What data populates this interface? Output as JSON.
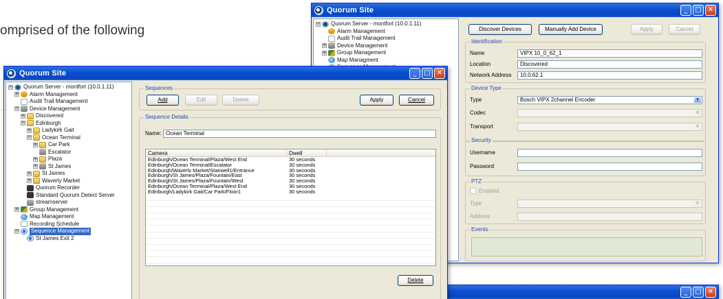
{
  "doc_text": "omprised of the following",
  "window_title": "Quorum Site",
  "title_buttons": {
    "minimize": "_",
    "maximize": "□",
    "close": "✕"
  },
  "tree_front": [
    {
      "label": "Quorum Server - montfort (10.0.1.11)",
      "icon": "server-icon",
      "exp": "⊟",
      "level": 0
    },
    {
      "label": "Alarm Management",
      "icon": "bulb-icon",
      "exp": "⊞",
      "level": 1
    },
    {
      "label": "Audit Trail Management",
      "icon": "doc-icon",
      "exp": "",
      "level": 1
    },
    {
      "label": "Device Management",
      "icon": "camera-icon",
      "exp": "⊟",
      "level": 1
    },
    {
      "label": "Discovered",
      "icon": "folder-icon",
      "exp": "⊞",
      "level": 2
    },
    {
      "label": "Edinburgh",
      "icon": "folder-icon",
      "exp": "⊟",
      "level": 2
    },
    {
      "label": "Ladykirk Gait",
      "icon": "folder-icon",
      "exp": "⊞",
      "level": 3
    },
    {
      "label": "Ocean Terminal",
      "icon": "folder-icon",
      "exp": "⊟",
      "level": 3
    },
    {
      "label": "Car Park",
      "icon": "folder-icon",
      "exp": "⊞",
      "level": 4
    },
    {
      "label": "Escalator",
      "icon": "camera-icon",
      "exp": "",
      "level": 4
    },
    {
      "label": "Plaza",
      "icon": "folder-icon",
      "exp": "⊞",
      "level": 4
    },
    {
      "label": "St James",
      "icon": "camera-icon",
      "exp": "⊞",
      "level": 4
    },
    {
      "label": "St James",
      "icon": "folder-icon",
      "exp": "⊞",
      "level": 3
    },
    {
      "label": "Waverly Market",
      "icon": "folder-icon",
      "exp": "⊞",
      "level": 3
    },
    {
      "label": "Quorum Recorder",
      "icon": "recorder-icon",
      "exp": "",
      "level": 2
    },
    {
      "label": "Standard Quorum Detect Server",
      "icon": "recorder-icon",
      "exp": "",
      "level": 2
    },
    {
      "label": "streamserver",
      "icon": "camera-icon",
      "exp": "",
      "level": 2
    },
    {
      "label": "Group Management",
      "icon": "group-icon",
      "exp": "⊞",
      "level": 1
    },
    {
      "label": "Map Management",
      "icon": "globe-icon",
      "exp": "",
      "level": 1
    },
    {
      "label": "Recording Schedule",
      "icon": "doc-icon",
      "exp": "",
      "level": 1
    },
    {
      "label": "Sequence Management",
      "icon": "sequence-icon",
      "exp": "⊟",
      "level": 1,
      "selected": true
    },
    {
      "label": "St James Exit 2",
      "icon": "sequence-icon",
      "exp": "",
      "level": 2
    }
  ],
  "sequences": {
    "group_title": "Sequences",
    "add": "Add",
    "edit": "Edit",
    "delete": "Delete",
    "apply": "Apply",
    "cancel": "Cancel"
  },
  "sequence_details": {
    "group_title": "Sequence Details",
    "name_label": "Name:",
    "name_value": "Ocean Terminal",
    "columns": [
      "Camera",
      "Dwell"
    ],
    "rows": [
      [
        "Edinburgh/Ocean Terminal/Plaza/West End",
        "30 seconds"
      ],
      [
        "Edinburgh/Ocean Terminal/Escalator",
        "30 seconds"
      ],
      [
        "Edinburgh/Waverly Market/Stairwell1/Entrance",
        "30 seconds"
      ],
      [
        "Edinburgh/St James/Plaza/Fountain/East",
        "30 seconds"
      ],
      [
        "Edinburgh/St James/Plaza/Fountain/West",
        "30 seconds"
      ],
      [
        "Edinburgh/Ocean Terminal/Plaza/West End",
        "30 seconds"
      ],
      [
        "Edinburgh/Ladykirk Gait/Car Park/Floor1",
        "30 seconds"
      ]
    ],
    "delete": "Delete"
  },
  "tree_back": [
    {
      "label": "Quorum Server - montfort (10.0.1.11)",
      "icon": "server-icon",
      "exp": "⊟"
    },
    {
      "label": "Alarm Management",
      "icon": "bulb-icon",
      "exp": ""
    },
    {
      "label": "Audit Trail Management",
      "icon": "doc-icon",
      "exp": ""
    },
    {
      "label": "Device Management",
      "icon": "camera-icon",
      "exp": "⊞"
    },
    {
      "label": "Group Management",
      "icon": "group-icon",
      "exp": "⊞"
    },
    {
      "label": "Map Managment",
      "icon": "globe-icon",
      "exp": ""
    },
    {
      "label": "Sequence Management",
      "icon": "sequence-icon",
      "exp": ""
    }
  ],
  "device": {
    "discover": "Discover Devices",
    "manual_add": "Manually Add Device",
    "apply": "Apply",
    "cancel": "Cancel",
    "identification": "Identification",
    "name_label": "Name",
    "name_value": "VIPX 10_0_62_1",
    "location_label": "Location",
    "location_value": "Discovered",
    "address_label": "Network Address",
    "address_value": "10.0.62.1",
    "device_type": "Device Type",
    "type_label": "Type",
    "type_value": "Bosch VIPX 2channel Encoder",
    "codec_label": "Codec",
    "transport_label": "Transport",
    "security": "Security",
    "username_label": "Username",
    "password_label": "Password",
    "ptz": "PTZ",
    "enabled_label": "Enabled",
    "ptz_type_label": "Type",
    "ptz_address_label": "Address",
    "events": "Events"
  },
  "colors": {
    "titlebar": "#0a4fd1",
    "selection": "#316ac5",
    "group_title": "#2146b5",
    "window_bg": "#ece9d8"
  }
}
